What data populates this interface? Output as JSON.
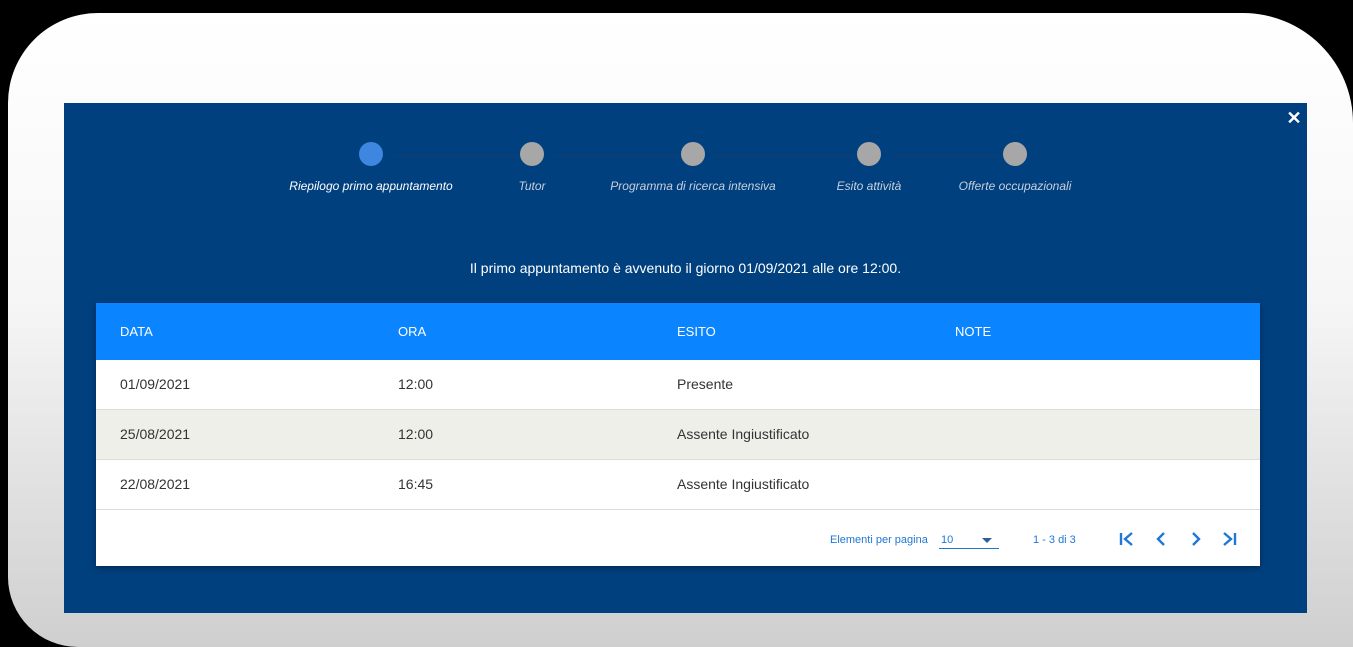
{
  "stepper": {
    "steps": [
      {
        "label": "Riepilogo primo appuntamento",
        "active": true
      },
      {
        "label": "Tutor",
        "active": false
      },
      {
        "label": "Programma di ricerca intensiva",
        "active": false
      },
      {
        "label": "Esito attività",
        "active": false
      },
      {
        "label": "Offerte occupazionali",
        "active": false
      }
    ]
  },
  "summary": {
    "text": "Il primo appuntamento è avvenuto il giorno 01/09/2021 alle ore 12:00."
  },
  "table": {
    "headers": [
      "DATA",
      "ORA",
      "ESITO",
      "NOTE"
    ],
    "rows": [
      [
        "01/09/2021",
        "12:00",
        "Presente",
        ""
      ],
      [
        "25/08/2021",
        "12:00",
        "Assente Ingiustificato",
        ""
      ],
      [
        "22/08/2021",
        "16:45",
        "Assente Ingiustificato",
        ""
      ]
    ]
  },
  "pagination": {
    "per_page_label": "Elementi per pagina",
    "per_page_value": "10",
    "range": "1 - 3 di 3"
  },
  "colors": {
    "modal_bg": "#00407f",
    "header_bg": "#0a84ff",
    "active_step": "#3d87e0",
    "inactive_step": "#a7a7a7",
    "link": "#1f77d6"
  },
  "icons": {
    "close": "close-icon",
    "first": "first-page-icon",
    "prev": "prev-page-icon",
    "next": "next-page-icon",
    "last": "last-page-icon"
  }
}
